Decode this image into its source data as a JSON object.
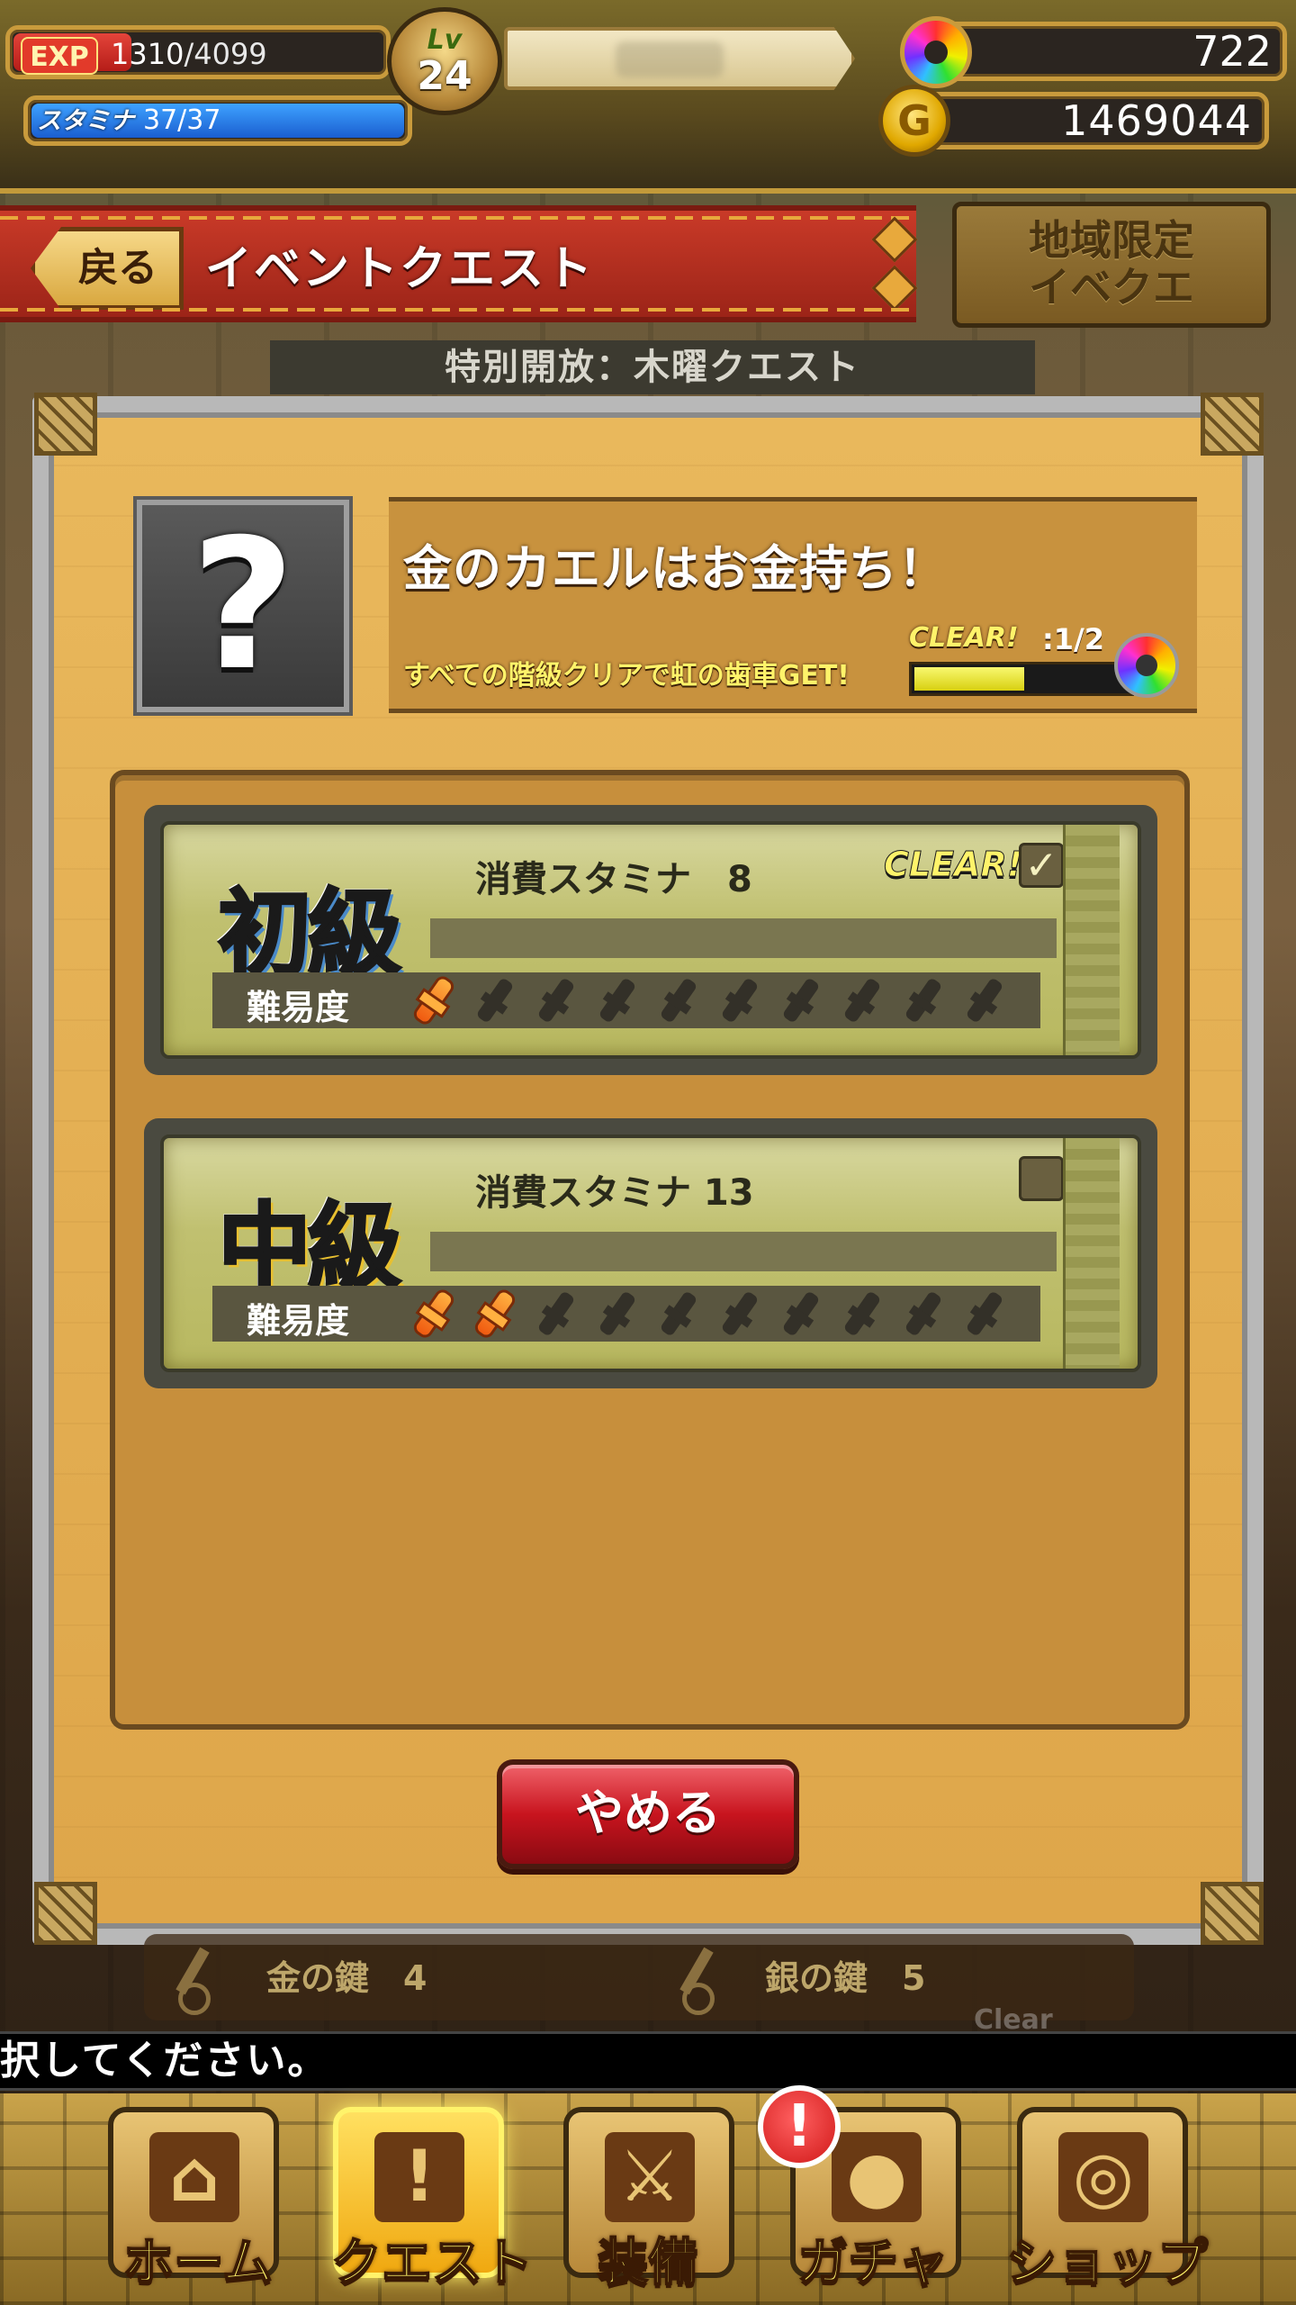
{
  "status": {
    "exp_label": "EXP",
    "exp_current": "1310",
    "exp_max": "/4099",
    "exp_fraction": 0.32,
    "stamina_label": "スタミナ",
    "stamina_value": "37/37",
    "stamina_fraction": 1.0,
    "level_label": "Lv",
    "level_value": "24",
    "gears": "722",
    "gold": "1469044",
    "gold_icon_letter": "G",
    "gear_icon": "rainbow-gear-icon",
    "gold_icon": "gold-coin-icon"
  },
  "header": {
    "back_label": "戻る",
    "title": "イベントクエスト",
    "region_button": "地域限定\nイベクエ"
  },
  "sub_header": "特別開放：木曜クエスト",
  "quest": {
    "icon_glyph": "?",
    "title": "金のカエルはお金持ち！",
    "reward_note": "すべての階級クリアで虹の歯車GET!",
    "clear_label": "CLEAR!",
    "clear_count": ":1/2",
    "clear_fraction": 0.5,
    "levels": [
      {
        "name": "初級",
        "stamina_text": "消費スタミナ　8",
        "difficulty_label": "難易度",
        "difficulty": 1,
        "difficulty_max": 10,
        "cleared": true,
        "clear_tag": "CLEAR!",
        "check_glyph": "✓"
      },
      {
        "name": "中級",
        "stamina_text": "消費スタミナ 13",
        "difficulty_label": "難易度",
        "difficulty": 2,
        "difficulty_max": 10,
        "cleared": false,
        "clear_tag": "",
        "check_glyph": ""
      }
    ]
  },
  "quit_button": "やめる",
  "behind": {
    "gold_key": "金の鍵　4",
    "silver_key": "銀の鍵　5",
    "clear_ghost": "Clear"
  },
  "message": "択してください。",
  "nav": {
    "alert": "!",
    "items": [
      {
        "label": "ホーム",
        "icon": "home-icon",
        "glyph": "⌂"
      },
      {
        "label": "クエスト",
        "icon": "quest-icon",
        "glyph": "!"
      },
      {
        "label": "装備",
        "icon": "equipment-icon",
        "glyph": "⚔"
      },
      {
        "label": "ガチャ",
        "icon": "gacha-icon",
        "glyph": "●"
      },
      {
        "label": "ショップ",
        "icon": "shop-icon",
        "glyph": "◎"
      }
    ],
    "active_index": 1
  }
}
